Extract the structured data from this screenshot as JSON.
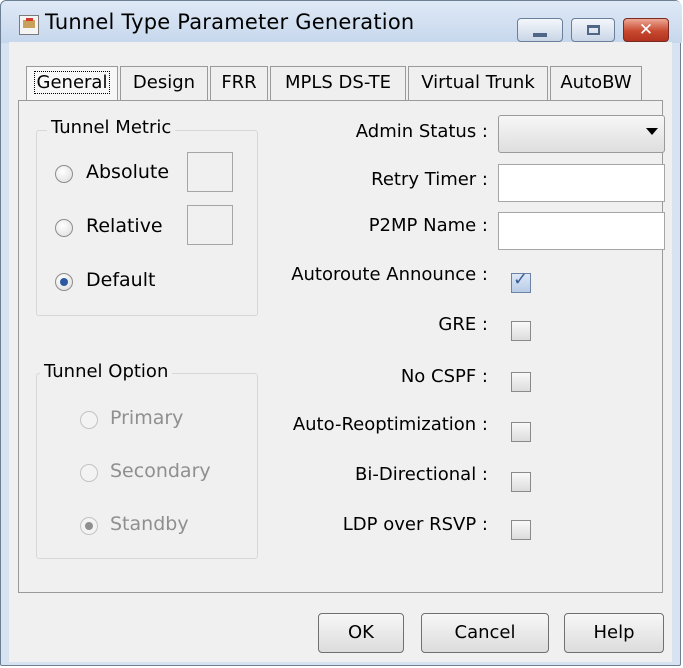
{
  "window": {
    "title": "Tunnel Type Parameter Generation"
  },
  "tabs": [
    {
      "label": "General"
    },
    {
      "label": "Design"
    },
    {
      "label": "FRR"
    },
    {
      "label": "MPLS DS-TE"
    },
    {
      "label": "Virtual Trunk"
    },
    {
      "label": "AutoBW"
    }
  ],
  "tunnel_metric": {
    "legend": "Tunnel Metric",
    "absolute_label": "Absolute",
    "relative_label": "Relative",
    "default_label": "Default",
    "selected": "Default"
  },
  "tunnel_option": {
    "legend": "Tunnel Option",
    "primary_label": "Primary",
    "secondary_label": "Secondary",
    "standby_label": "Standby",
    "selected": "Standby"
  },
  "fields": {
    "admin_status": {
      "label": "Admin Status :",
      "value": ""
    },
    "retry_timer": {
      "label": "Retry Timer :",
      "value": ""
    },
    "p2mp_name": {
      "label": "P2MP Name :",
      "value": ""
    }
  },
  "checks": [
    {
      "label": "Autoroute Announce :",
      "checked": true
    },
    {
      "label": "GRE :",
      "checked": false
    },
    {
      "label": "No CSPF :",
      "checked": false
    },
    {
      "label": "Auto-Reoptimization :",
      "checked": false
    },
    {
      "label": "Bi-Directional :",
      "checked": false
    },
    {
      "label": "LDP over RSVP :",
      "checked": false
    }
  ],
  "buttons": {
    "ok": "OK",
    "cancel": "Cancel",
    "help": "Help"
  }
}
